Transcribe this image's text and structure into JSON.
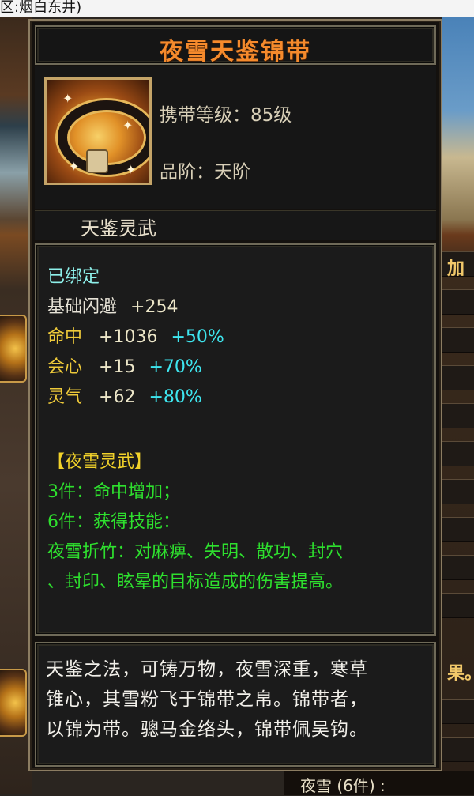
{
  "browser": {
    "top_text": "区:烟白东井)"
  },
  "background": {
    "right_texts": [
      "加",
      "果。"
    ],
    "bottom_text": "夜雪 (6件) :"
  },
  "item": {
    "name": "夜雪天鉴锦带",
    "level_label": "携带等级：85级",
    "grade_label": "品阶：天阶",
    "series": "天鉴灵武",
    "bound": "已绑定",
    "stats": [
      {
        "name": "基础闪避",
        "value": "+254",
        "bonus": ""
      },
      {
        "name": "命中",
        "value": "+1036",
        "bonus": "+50%"
      },
      {
        "name": "会心",
        "value": "+15",
        "bonus": "+70%"
      },
      {
        "name": "灵气",
        "value": "+62",
        "bonus": "+80%"
      }
    ],
    "set_name": "【夜雪灵武】",
    "set_bonus_3": "3件：命中增加；",
    "set_bonus_6": "6件：获得技能：",
    "skill_line1": "夜雪折竹：对麻痹、失明、散功、封穴",
    "skill_line2": "、封印、眩晕的目标造成的伤害提高。",
    "description": [
      "天鉴之法，可铸万物，夜雪深重，寒草",
      "锥心，其雪粉飞于锦带之帛。锦带者，",
      "以锦为带。骢马金络头，锦带佩吴钩。"
    ]
  },
  "colors": {
    "title": "#f58a2c",
    "bound": "#8ef0ea",
    "stat_name": "#eeca3a",
    "bonus": "#3ee6ef",
    "set_text": "#2ee02e",
    "set_name": "#f2d22a"
  }
}
